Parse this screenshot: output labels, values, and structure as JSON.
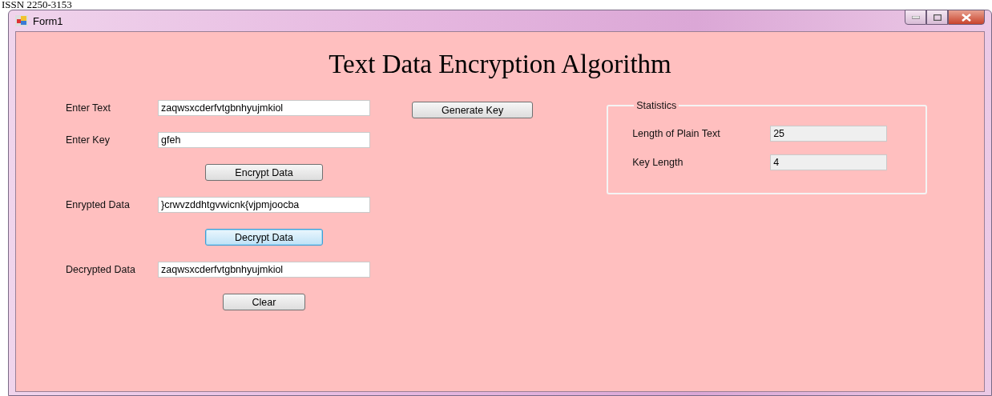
{
  "page_header": "ISSN 2250-3153",
  "window": {
    "title": "Form1"
  },
  "heading": "Text Data Encryption Algorithm",
  "form_rows": [
    {
      "kind": "field",
      "label": "Enter Text",
      "value": "zaqwsxcderfvtgbnhyujmkiol"
    },
    {
      "kind": "field",
      "label": "Enter Key",
      "value": "gfeh"
    },
    {
      "kind": "button",
      "label": "Encrypt Data",
      "focused": false
    },
    {
      "kind": "field",
      "label": "Enrypted Data",
      "value": "}crwvzddhtgvwicnk{vjpmjoocba"
    },
    {
      "kind": "button",
      "label": "Decrypt Data",
      "focused": true
    },
    {
      "kind": "field",
      "label": "Decrypted Data",
      "value": "zaqwsxcderfvtgbnhyujmkiol"
    },
    {
      "kind": "button",
      "label": "Clear",
      "focused": false
    }
  ],
  "generate_button": {
    "label": "Generate Key"
  },
  "statistics": {
    "title": "Statistics",
    "rows": [
      {
        "label": "Length of Plain Text",
        "value": "25"
      },
      {
        "label": "Key Length",
        "value": "4"
      }
    ]
  }
}
